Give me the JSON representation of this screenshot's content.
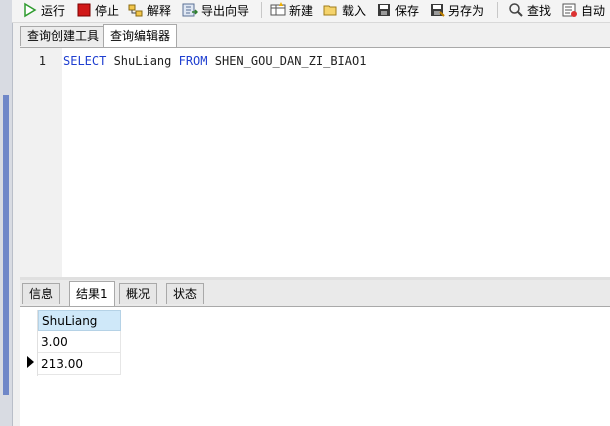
{
  "toolbar": {
    "run": "运行",
    "stop": "停止",
    "explain": "解释",
    "export_wizard": "导出向导",
    "new": "新建",
    "load": "载入",
    "save": "保存",
    "save_as": "另存为",
    "find": "查找",
    "auto": "自动"
  },
  "doc_tabs": [
    "查询创建工具",
    "查询编辑器"
  ],
  "editor": {
    "line_number": "1",
    "kw_select": "SELECT",
    "column": " ShuLiang ",
    "kw_from": "FROM",
    "table": " SHEN_GOU_DAN_ZI_BIAO1"
  },
  "result_tabs": [
    "信息",
    "结果1",
    "概况",
    "状态"
  ],
  "grid": {
    "header": "ShuLiang",
    "rows": [
      "3.00",
      "213.00"
    ]
  },
  "colors": {
    "keyword": "#1f3fd0",
    "header_bg": "#cfe8f9",
    "run_icon": "#2e9b2e",
    "stop_icon": "#d01818"
  }
}
